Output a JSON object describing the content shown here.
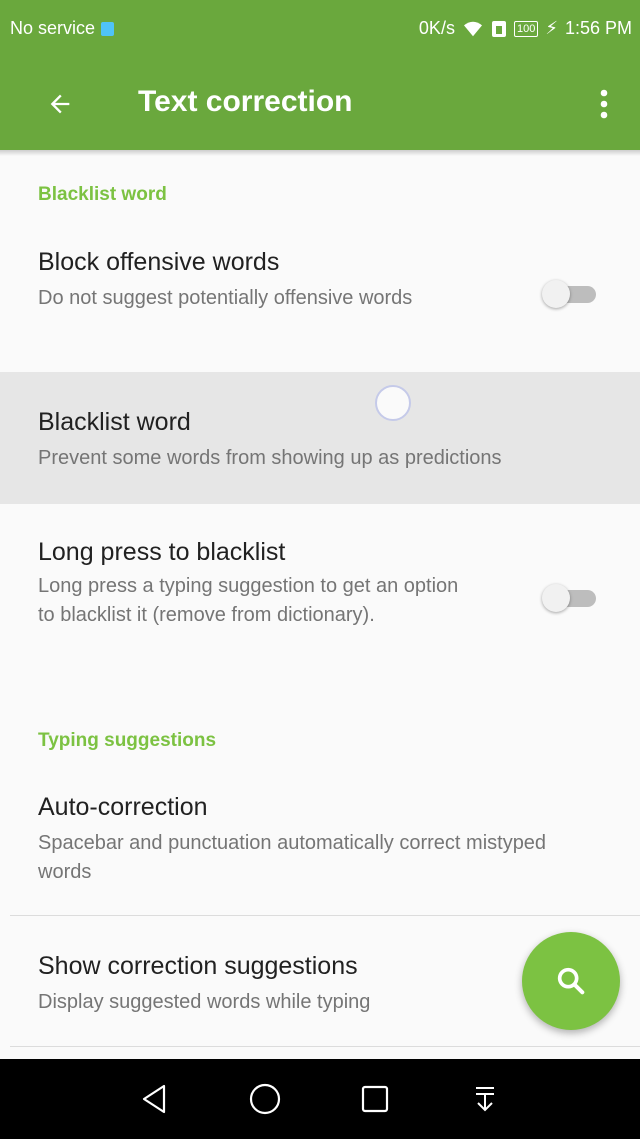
{
  "status_bar": {
    "carrier": "No service",
    "speed": "0K/s",
    "battery": "100",
    "time": "1:56 PM",
    "icons": [
      "sim-icon",
      "wifi-icon",
      "phone-data-icon",
      "battery-icon",
      "charging-icon"
    ]
  },
  "app_bar": {
    "title": "Text correction",
    "back_icon": "arrow-left-icon",
    "menu_icon": "more-vert-icon"
  },
  "sections": [
    {
      "header": "Blacklist word",
      "items": [
        {
          "title": "Block offensive words",
          "summary": "Do not suggest potentially offensive words",
          "has_switch": true,
          "checked": false
        },
        {
          "title": "Blacklist word",
          "summary": "Prevent some words from showing up as predictions",
          "has_switch": false,
          "pressed": true
        },
        {
          "title": "Long press to blacklist",
          "summary": "Long press a typing suggestion to get an option to blacklist it (remove from dictionary).",
          "has_switch": true,
          "checked": false
        }
      ]
    },
    {
      "header": "Typing suggestions",
      "items": [
        {
          "title": "Auto-correction",
          "summary": "Spacebar and punctuation automatically correct mistyped words",
          "has_switch": false
        },
        {
          "title": "Show correction suggestions",
          "summary": "Display suggested words while typing",
          "has_switch": false
        }
      ]
    }
  ],
  "fab": {
    "icon": "search-icon"
  },
  "nav_bar": {
    "icons": [
      "back-triangle-icon",
      "home-circle-icon",
      "recents-square-icon",
      "notification-pull-icon"
    ]
  },
  "colors": {
    "primary": "#6aa83d",
    "accent": "#7cc242"
  }
}
